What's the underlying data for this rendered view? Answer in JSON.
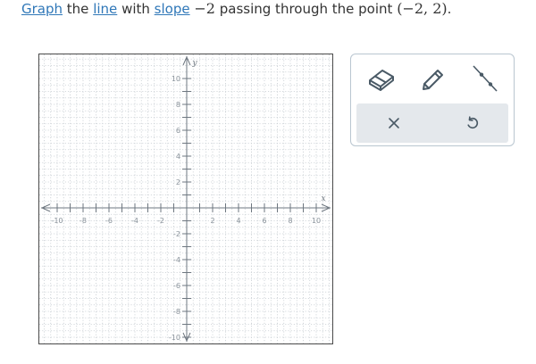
{
  "prompt": {
    "word_graph": "Graph",
    "word_the": "the",
    "word_line": "line",
    "word_with": "with",
    "word_slope": "slope",
    "slope_value": "−2",
    "word_passing": "passing through the point",
    "point": "(−2, 2)",
    "period": "."
  },
  "graph": {
    "x_label": "x",
    "y_label": "y",
    "x_ticks": [
      "-10",
      "-8",
      "-6",
      "-4",
      "-2",
      "2",
      "4",
      "6",
      "8",
      "10"
    ],
    "y_ticks": [
      "10",
      "8",
      "6",
      "4",
      "2",
      "-2",
      "-4",
      "-6",
      "-8",
      "-10"
    ],
    "x_range": [
      -10,
      10
    ],
    "y_range": [
      -10,
      10
    ],
    "grid": true
  },
  "toolbar": {
    "tools": [
      {
        "name": "eraser-tool",
        "icon": "eraser-icon"
      },
      {
        "name": "pencil-tool",
        "icon": "pencil-icon"
      },
      {
        "name": "line-tool",
        "icon": "line-segment-icon"
      }
    ],
    "actions": [
      {
        "name": "clear-button",
        "icon": "close-icon"
      },
      {
        "name": "undo-button",
        "icon": "undo-icon"
      }
    ],
    "accent_color": "#2f77b8",
    "icon_color": "#4a5a66",
    "action_bar_color": "#e4e8ec"
  }
}
